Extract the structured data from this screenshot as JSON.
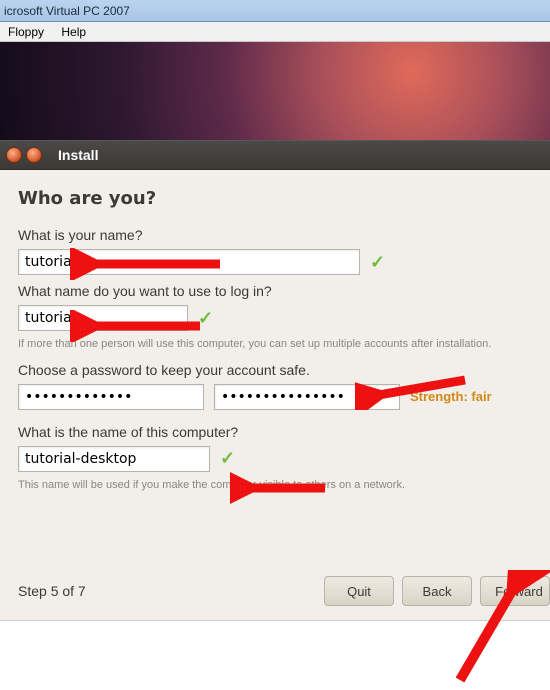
{
  "vpc": {
    "title": "icrosoft Virtual PC 2007",
    "menu": {
      "floppy": "Floppy",
      "help": "Help"
    }
  },
  "installer_title": "Install",
  "heading": "Who are you?",
  "name": {
    "question": "What is your name?",
    "value": "tutorial"
  },
  "login": {
    "question": "What name do you want to use to log in?",
    "value": "tutorial",
    "hint": "If more than one person will use this computer, you can set up multiple accounts after installation."
  },
  "password": {
    "question": "Choose a password to keep your account safe.",
    "value1": "•••••••••••••",
    "value2": "•••••••••••••••",
    "strength_label": "Strength: fair"
  },
  "computer": {
    "question": "What is the name of this computer?",
    "value": "tutorial-desktop",
    "hint": "This name will be used if you make the computer visible to others on a network."
  },
  "step_label": "Step 5 of 7",
  "buttons": {
    "quit": "Quit",
    "back": "Back",
    "forward": "Forward"
  }
}
